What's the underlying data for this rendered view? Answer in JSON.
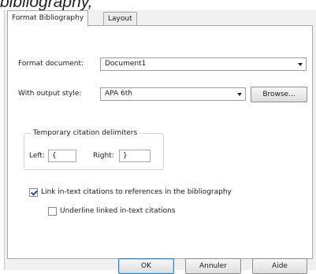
{
  "caption": "bibliography,",
  "tabs": [
    {
      "label": "Format Bibliography"
    },
    {
      "label": "Layout"
    }
  ],
  "format_document": {
    "label": "Format document:",
    "value": "Document1"
  },
  "output_style": {
    "label": "With output style:",
    "value": "APA 6th",
    "browse_label": "Browse..."
  },
  "delimiters": {
    "title": "Temporary citation delimiters",
    "left_label": "Left:",
    "left_value": "{",
    "right_label": "Right:",
    "right_value": "}"
  },
  "options": {
    "link_label": "Link in-text citations to references in the bibliography",
    "link_checked": true,
    "underline_label": "Underline linked in-text citations",
    "underline_checked": false
  },
  "buttons": {
    "ok": "OK",
    "cancel": "Annuler",
    "help": "Aide"
  }
}
